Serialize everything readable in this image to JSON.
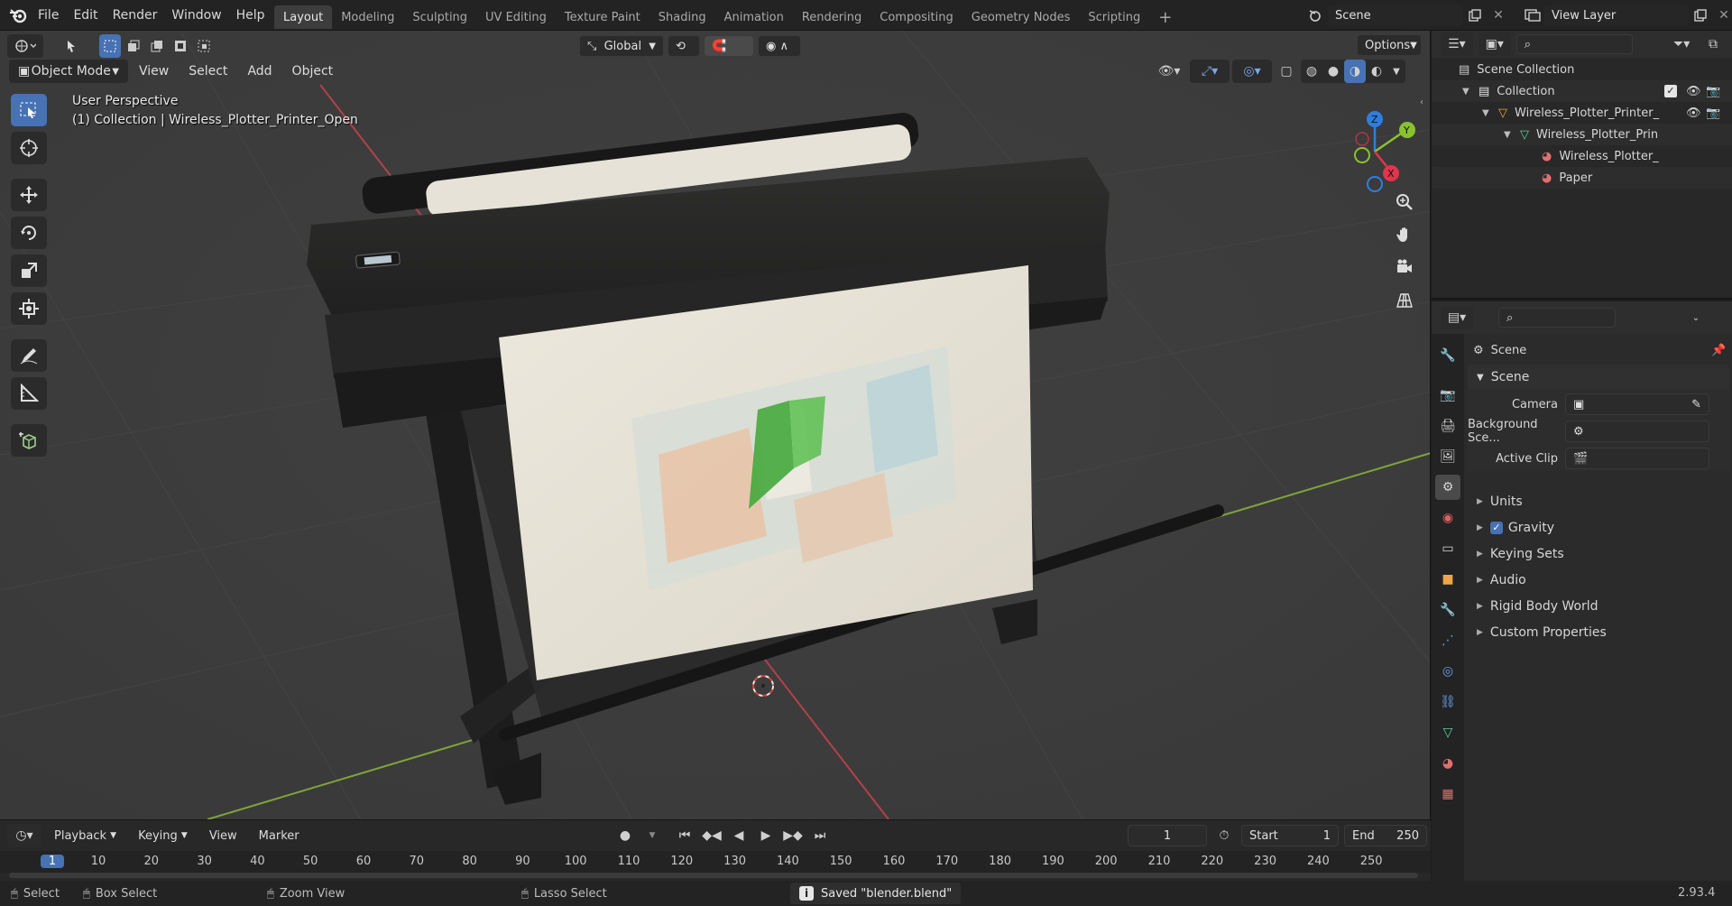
{
  "menubar": {
    "items": [
      "File",
      "Edit",
      "Render",
      "Window",
      "Help"
    ],
    "workspaces": [
      "Layout",
      "Modeling",
      "Sculpting",
      "UV Editing",
      "Texture Paint",
      "Shading",
      "Animation",
      "Rendering",
      "Compositing",
      "Geometry Nodes",
      "Scripting"
    ],
    "active_workspace": "Layout",
    "scene_name": "Scene",
    "view_layer": "View Layer"
  },
  "viewport_header": {
    "mode": "Object Mode",
    "menus": [
      "View",
      "Select",
      "Add",
      "Object"
    ],
    "transform_orientation": "Global",
    "options_label": "Options"
  },
  "viewport": {
    "perspective_label": "User Perspective",
    "collection_label": "(1) Collection | Wireless_Plotter_Printer_Open",
    "axes": {
      "x": "X",
      "y": "Y",
      "z": "Z"
    }
  },
  "outliner": {
    "root": "Scene Collection",
    "items": [
      {
        "label": "Collection",
        "level": 1
      },
      {
        "label": "Wireless_Plotter_Printer_",
        "level": 2
      },
      {
        "label": "Wireless_Plotter_Prin",
        "level": 3
      },
      {
        "label": "Wireless_Plotter_",
        "level": 4
      },
      {
        "label": "Paper",
        "level": 4
      }
    ]
  },
  "properties": {
    "context": "Scene",
    "panel_title": "Scene",
    "fields": {
      "camera_label": "Camera",
      "background_label": "Background Sce...",
      "active_clip_label": "Active Clip"
    },
    "subpanels": [
      "Units",
      "Gravity",
      "Keying Sets",
      "Audio",
      "Rigid Body World",
      "Custom Properties"
    ],
    "gravity_checked": true
  },
  "timeline": {
    "menus": [
      "Playback",
      "Keying",
      "View",
      "Marker"
    ],
    "current_frame": "1",
    "start_label": "Start",
    "start_value": "1",
    "end_label": "End",
    "end_value": "250",
    "ruler": [
      "1",
      "10",
      "20",
      "30",
      "40",
      "50",
      "60",
      "70",
      "80",
      "90",
      "100",
      "110",
      "120",
      "130",
      "140",
      "150",
      "160",
      "170",
      "180",
      "190",
      "200",
      "210",
      "220",
      "230",
      "240",
      "250"
    ]
  },
  "statusbar": {
    "select": "Select",
    "box_select": "Box Select",
    "zoom_view": "Zoom View",
    "lasso_select": "Lasso Select",
    "message": "Saved \"blender.blend\"",
    "version": "2.93.4"
  },
  "colors": {
    "accent": "#4772b3",
    "x_axis": "#e0354b",
    "y_axis": "#8ac22f",
    "z_axis": "#2f7de0"
  }
}
